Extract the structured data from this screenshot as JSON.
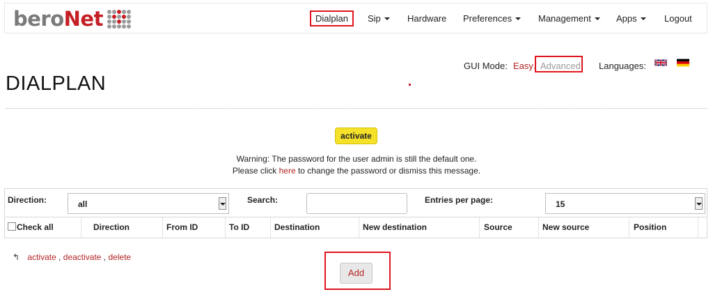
{
  "brand": {
    "part1": "bero",
    "part2": "Net"
  },
  "nav": {
    "dialplan": "Dialplan",
    "sip": "Sip",
    "hardware": "Hardware",
    "preferences": "Preferences",
    "management": "Management",
    "apps": "Apps",
    "logout": "Logout"
  },
  "gui": {
    "label": "GUI Mode:",
    "easy": "Easy",
    "separator": "/",
    "advanced": "Advanced",
    "languages_label": "Languages:",
    "languages": [
      "English",
      "Deutsch"
    ]
  },
  "page": {
    "title": "DIALPLAN"
  },
  "activate_button": "activate",
  "warning": {
    "line1": "Warning: The password for the user admin is still the default one.",
    "line2_pre": "Please click ",
    "line2_link": "here",
    "line2_post": " to change the password or dismiss this message."
  },
  "filter": {
    "direction_label": "Direction:",
    "direction_value": "all",
    "search_label": "Search:",
    "search_value": "",
    "entries_label": "Entries per page:",
    "entries_value": "15"
  },
  "table": {
    "columns": [
      "Check all",
      "Direction",
      "From ID",
      "To ID",
      "Destination",
      "New destination",
      "Source",
      "New source",
      "Position"
    ]
  },
  "actions": {
    "activate": "activate",
    "deactivate": "deactivate",
    "delete": "delete",
    "sep": " , "
  },
  "add_button": "Add",
  "colors": {
    "brand_red": "#c41f24",
    "link_red": "#b22222",
    "highlight": "#e0141e",
    "activate_yellow": "#f5e12a"
  }
}
